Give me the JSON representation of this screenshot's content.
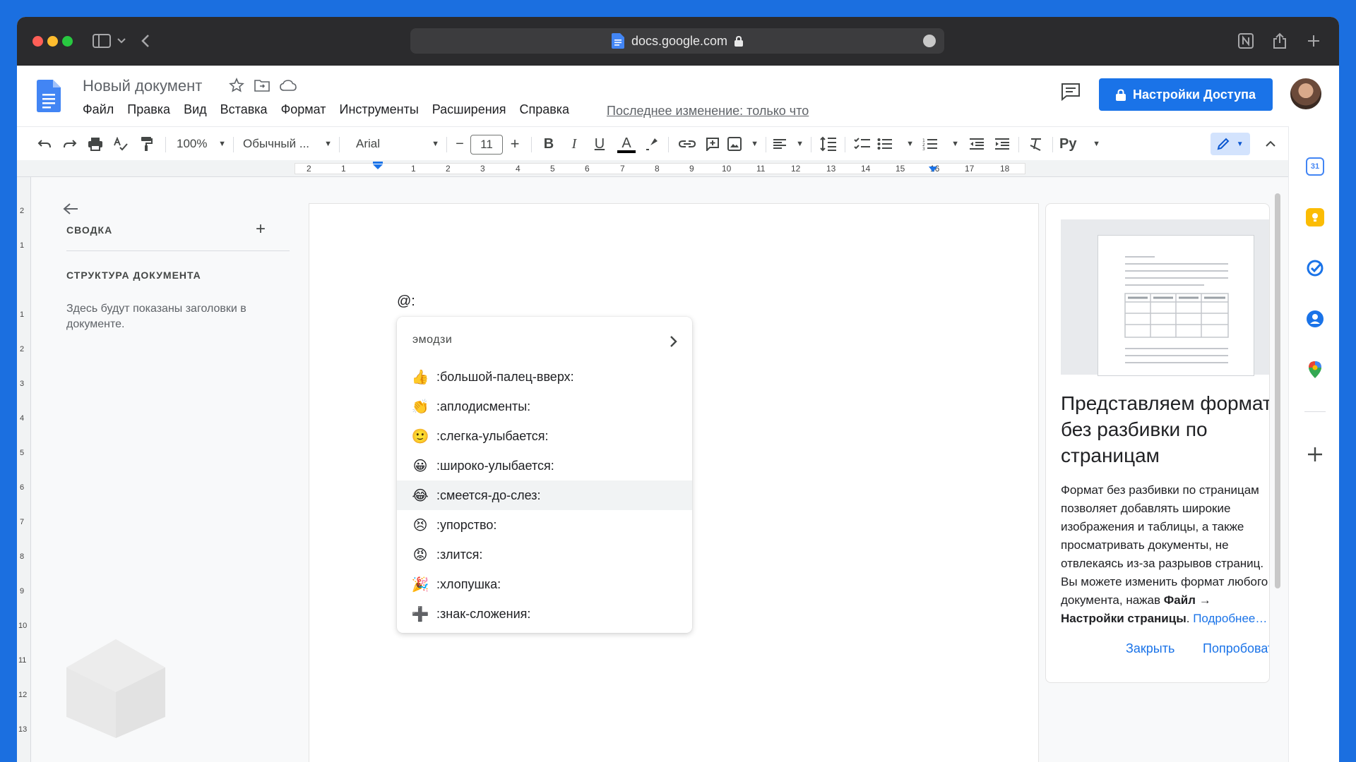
{
  "browser": {
    "url": "docs.google.com"
  },
  "header": {
    "doc_title": "Новый документ",
    "menu": [
      "Файл",
      "Правка",
      "Вид",
      "Вставка",
      "Формат",
      "Инструменты",
      "Расширения",
      "Справка"
    ],
    "last_edit": "Последнее изменение: только что",
    "share_label": "Настройки Доступа"
  },
  "toolbar": {
    "zoom": "100%",
    "style": "Обычный ...",
    "font": "Arial",
    "font_size": "11",
    "bold": "B",
    "italic": "I",
    "underline": "U",
    "text_color": "A",
    "input_tools": "Py"
  },
  "ruler": {
    "h_ticks": [
      "2",
      "1",
      "1",
      "2",
      "3",
      "4",
      "5",
      "6",
      "7",
      "8",
      "9",
      "10",
      "11",
      "12",
      "13",
      "14",
      "15",
      "16",
      "17",
      "18"
    ],
    "v_ticks": [
      "2",
      "1",
      "1",
      "2",
      "3",
      "4",
      "5",
      "6",
      "7",
      "8",
      "9",
      "10",
      "11",
      "12",
      "13"
    ]
  },
  "outline": {
    "summary_title": "СВОДКА",
    "structure_title": "СТРУКТУРА ДОКУМЕНТА",
    "hint": "Здесь будут показаны заголовки в документе."
  },
  "document": {
    "typed": "@:"
  },
  "emoji_popup": {
    "header": "эмодзи",
    "items": [
      {
        "emoji": "👍",
        "label": ":большой-палец-вверх:"
      },
      {
        "emoji": "👏",
        "label": ":аплодисменты:"
      },
      {
        "emoji": "🙂",
        "label": ":слегка-улыбается:"
      },
      {
        "emoji": "😀",
        "label": ":широко-улыбается:"
      },
      {
        "emoji": "😂",
        "label": ":смеется-до-слез:"
      },
      {
        "emoji": "😣",
        "label": ":упорство:"
      },
      {
        "emoji": "😡",
        "label": ":злится:"
      },
      {
        "emoji": "🎉",
        "label": ":хлопушка:"
      },
      {
        "emoji": "➕",
        "label": ":знак-сложения:"
      }
    ],
    "active_index": 4
  },
  "side_panel": {
    "title": "Представляем формат без разбивки по страницам",
    "body_lines": [
      "Формат без разбивки по страницам",
      "позволяет добавлять широкие",
      "изображения и таблицы, а также",
      "просматривать документы, не",
      "отвлекаясь из-за разрывов страниц.",
      "Вы можете изменить формат любого"
    ],
    "body_pre": "документа, нажав ",
    "body_bold": "Файл → Настройки страницы",
    "body_post": ". ",
    "learn_more": "Подробнее…",
    "close_label": "Закрыть",
    "try_label": "Попробовать"
  },
  "colors": {
    "accent": "#1a73e8",
    "titlebar": "#2b2b2d",
    "desktop": "#1b6fe0"
  }
}
